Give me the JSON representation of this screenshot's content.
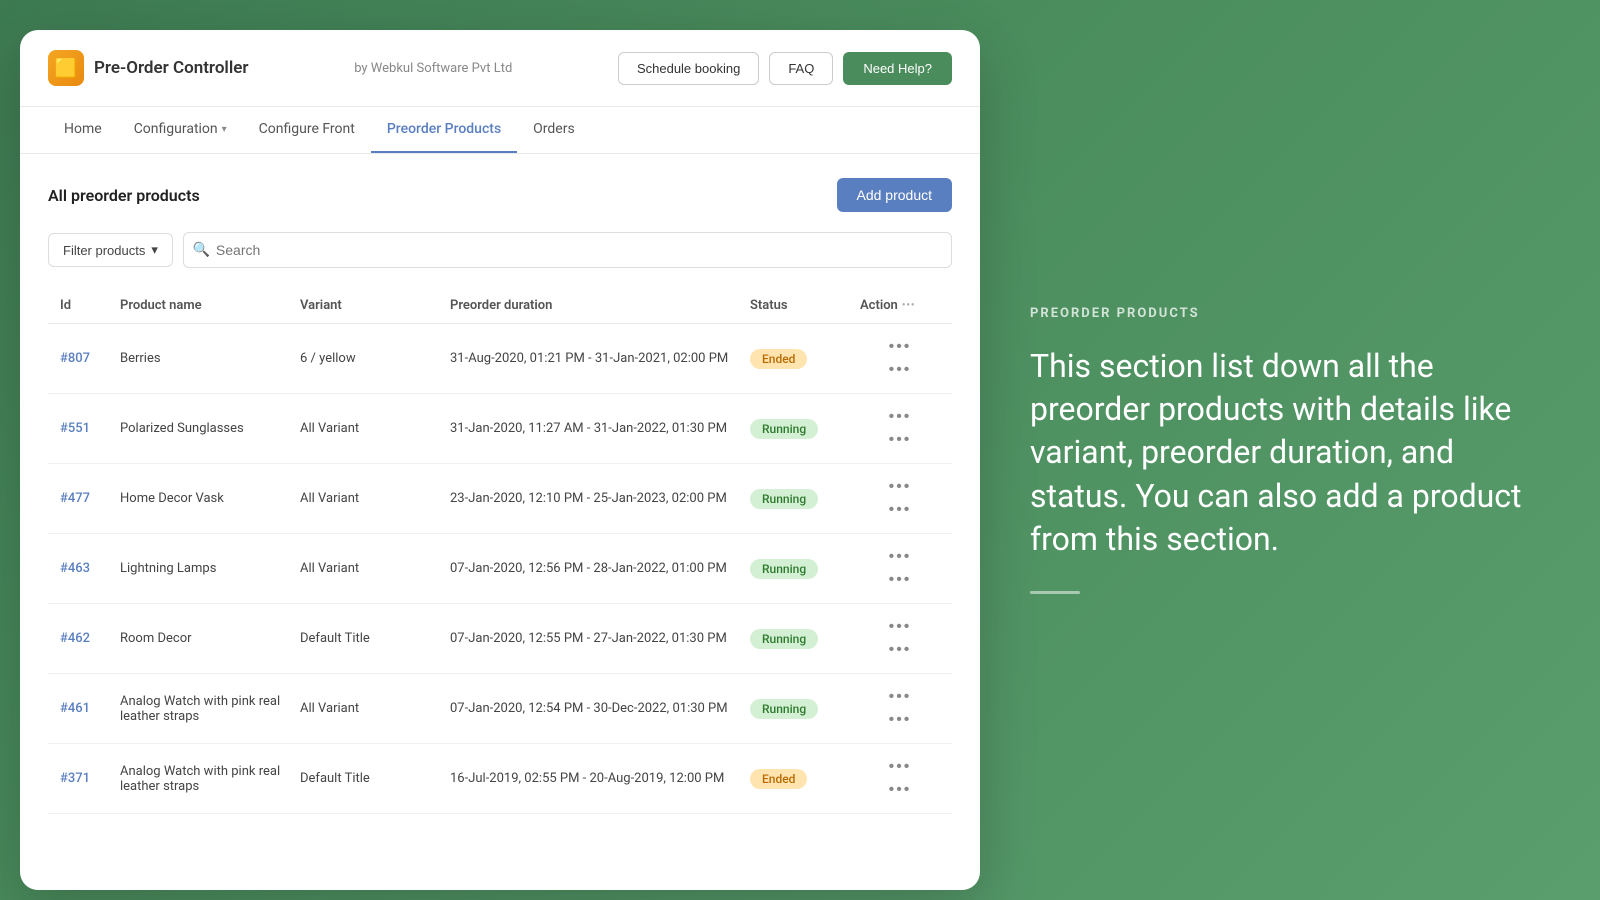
{
  "app": {
    "logo_emoji": "🟨",
    "title": "Pre-Order Controller",
    "vendor": "by Webkul Software Pvt Ltd"
  },
  "header": {
    "schedule_btn": "Schedule booking",
    "faq_btn": "FAQ",
    "need_help_btn": "Need Help?"
  },
  "nav": {
    "items": [
      {
        "label": "Home",
        "active": false
      },
      {
        "label": "Configuration",
        "active": false,
        "dropdown": true
      },
      {
        "label": "Configure Front",
        "active": false
      },
      {
        "label": "Preorder Products",
        "active": true
      },
      {
        "label": "Orders",
        "active": false
      }
    ]
  },
  "content": {
    "page_title": "All preorder products",
    "add_product_btn": "Add product",
    "filter_btn": "Filter products",
    "search_placeholder": "Search"
  },
  "table": {
    "columns": [
      "Id",
      "Product name",
      "Variant",
      "Preorder duration",
      "Status",
      "Action"
    ],
    "rows": [
      {
        "id": "#807",
        "name": "Berries",
        "variant": "6 / yellow",
        "duration": "31-Aug-2020, 01:21 PM - 31-Jan-2021, 02:00 PM",
        "status": "Ended",
        "status_type": "ended"
      },
      {
        "id": "#551",
        "name": "Polarized Sunglasses",
        "variant": "All Variant",
        "duration": "31-Jan-2020, 11:27 AM - 31-Jan-2022, 01:30 PM",
        "status": "Running",
        "status_type": "running"
      },
      {
        "id": "#477",
        "name": "Home Decor Vask",
        "variant": "All Variant",
        "duration": "23-Jan-2020, 12:10 PM - 25-Jan-2023, 02:00 PM",
        "status": "Running",
        "status_type": "running"
      },
      {
        "id": "#463",
        "name": "Lightning Lamps",
        "variant": "All Variant",
        "duration": "07-Jan-2020, 12:56 PM - 28-Jan-2022, 01:00 PM",
        "status": "Running",
        "status_type": "running"
      },
      {
        "id": "#462",
        "name": "Room Decor",
        "variant": "Default Title",
        "duration": "07-Jan-2020, 12:55 PM - 27-Jan-2022, 01:30 PM",
        "status": "Running",
        "status_type": "running"
      },
      {
        "id": "#461",
        "name": "Analog Watch with pink real leather straps",
        "variant": "All Variant",
        "duration": "07-Jan-2020, 12:54 PM - 30-Dec-2022, 01:30 PM",
        "status": "Running",
        "status_type": "running"
      },
      {
        "id": "#371",
        "name": "Analog Watch with pink real leather straps",
        "variant": "Default Title",
        "duration": "16-Jul-2019, 02:55 PM - 20-Aug-2019, 12:00 PM",
        "status": "Ended",
        "status_type": "ended"
      }
    ]
  },
  "right": {
    "section_label": "PREORDER PRODUCTS",
    "description": "This section list down all the preorder products with details like variant, preorder duration, and status. You can also add a product from this section."
  },
  "icons": {
    "dots": "•••",
    "search": "🔍",
    "chevron_down": "▾"
  }
}
